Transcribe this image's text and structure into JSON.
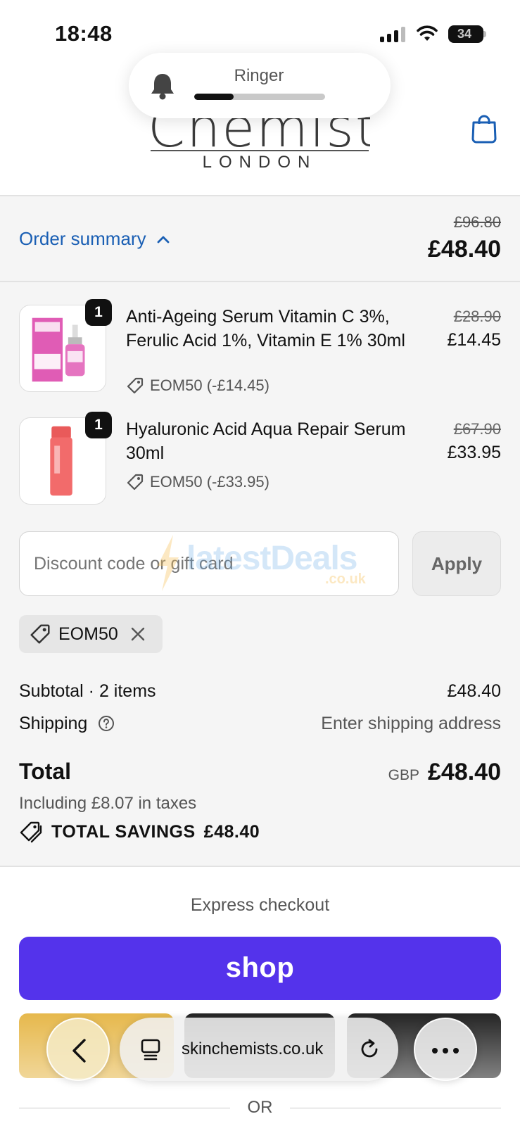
{
  "status_bar": {
    "time": "18:48",
    "battery": "34"
  },
  "ringer": {
    "label": "Ringer",
    "level": 0.3
  },
  "header": {
    "logo_main": "Chemists",
    "logo_sub": "LONDON"
  },
  "summary": {
    "toggle_label": "Order summary",
    "original_total": "£96.80",
    "total": "£48.40"
  },
  "items": [
    {
      "qty": "1",
      "name": "Anti-Ageing Serum Vitamin C 3%, Ferulic Acid 1%, Vitamin E 1% 30ml",
      "discount": "EOM50 (-£14.45)",
      "original_price": "£28.90",
      "price": "£14.45",
      "accent": "#e05cb5"
    },
    {
      "qty": "1",
      "name": "Hyaluronic Acid Aqua Repair Serum 30ml",
      "discount": "EOM50 (-£33.95)",
      "original_price": "£67.90",
      "price": "£33.95",
      "accent": "#f26b6b"
    }
  ],
  "discount": {
    "placeholder": "Discount code or gift card",
    "apply_label": "Apply",
    "applied_code": "EOM50"
  },
  "watermark": {
    "text": "latestDeals",
    "sub": ".co.uk"
  },
  "totals": {
    "subtotal_label": "Subtotal · 2 items",
    "subtotal_value": "£48.40",
    "shipping_label": "Shipping",
    "shipping_value": "Enter shipping address",
    "total_label": "Total",
    "currency": "GBP",
    "total_value": "£48.40",
    "taxes": "Including £8.07 in taxes",
    "savings_label": "TOTAL SAVINGS",
    "savings_value": "£48.40"
  },
  "express": {
    "title": "Express checkout",
    "shop_label": "shop",
    "or_label": "OR"
  },
  "safari": {
    "url": "skinchemists.co.uk"
  },
  "colors": {
    "link": "#1a5fb4",
    "shop": "#5433eb",
    "paypal": "#e4b23c"
  }
}
